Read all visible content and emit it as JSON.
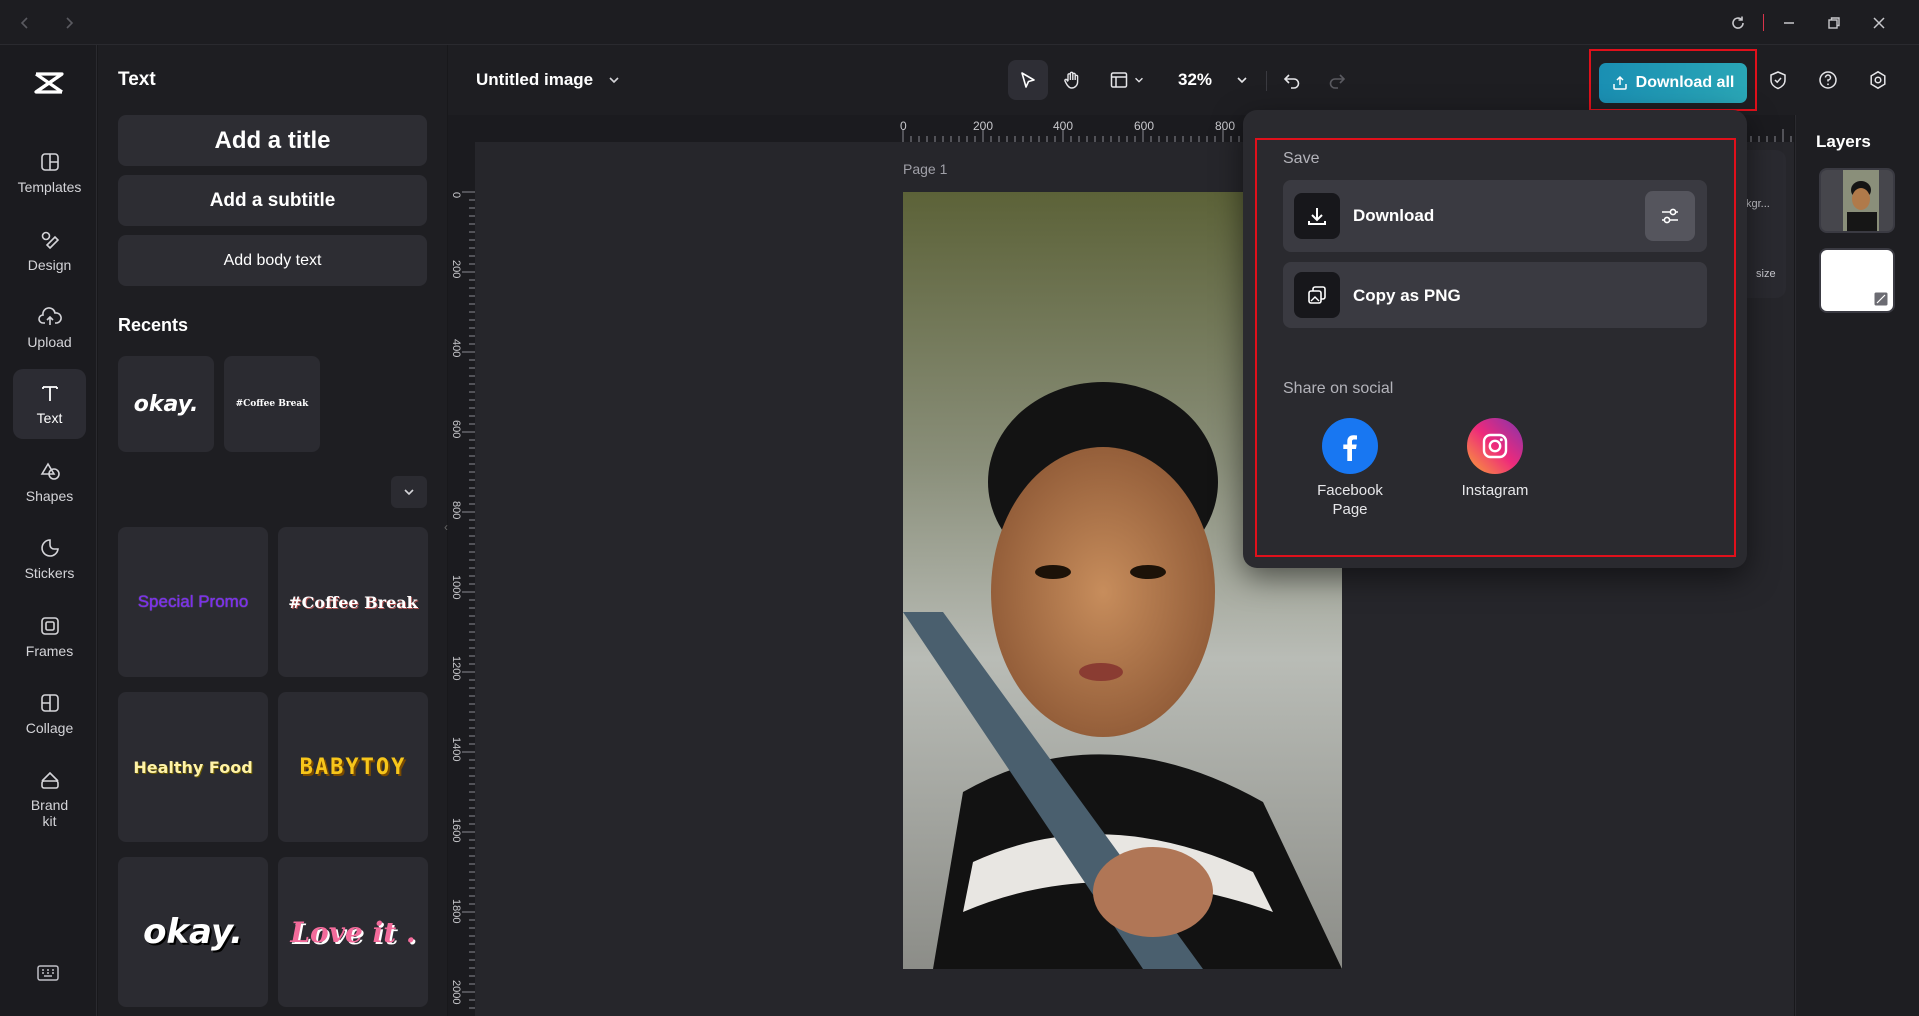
{
  "app": {
    "doc_title": "Untitled image",
    "zoom": "32%",
    "download_all_label": "Download all"
  },
  "rail": {
    "items": [
      {
        "label": "Templates",
        "icon": "templates-icon"
      },
      {
        "label": "Design",
        "icon": "design-icon"
      },
      {
        "label": "Upload",
        "icon": "upload-icon"
      },
      {
        "label": "Text",
        "icon": "text-icon",
        "active": true
      },
      {
        "label": "Shapes",
        "icon": "shapes-icon"
      },
      {
        "label": "Stickers",
        "icon": "stickers-icon"
      },
      {
        "label": "Frames",
        "icon": "frames-icon"
      },
      {
        "label": "Collage",
        "icon": "collage-icon"
      },
      {
        "label": "Brand kit",
        "icon": "brand-kit-icon"
      }
    ]
  },
  "text_panel": {
    "title": "Text",
    "add_title": "Add a title",
    "add_subtitle": "Add a subtitle",
    "add_body": "Add body text",
    "recents_title": "Recents",
    "recents": [
      "okay.",
      "#Coffee Break"
    ],
    "styles": [
      "Special Promo",
      "#Coffee Break",
      "Healthy Food",
      "BABYTOY",
      "okay.",
      "Love it ."
    ]
  },
  "canvas": {
    "page_label": "Page 1",
    "ruler_top": [
      "0",
      "200",
      "400",
      "600",
      "800"
    ],
    "ruler_left": [
      "0",
      "200",
      "400",
      "600",
      "800",
      "1000",
      "1200",
      "1400",
      "1600",
      "1800",
      "2000"
    ],
    "side_tools": [
      "kgr...",
      "size"
    ]
  },
  "layers": {
    "title": "Layers"
  },
  "popup": {
    "save_label": "Save",
    "download_label": "Download",
    "copy_label": "Copy as PNG",
    "share_label": "Share on social",
    "social": [
      {
        "label": "Facebook Page",
        "color": "#1877f2"
      },
      {
        "label": "Instagram",
        "color": "#e1306c"
      }
    ]
  },
  "colors": {
    "accent": "#1a8fb3",
    "highlight": "#e0101b",
    "active_bg": "#2c2c33"
  }
}
